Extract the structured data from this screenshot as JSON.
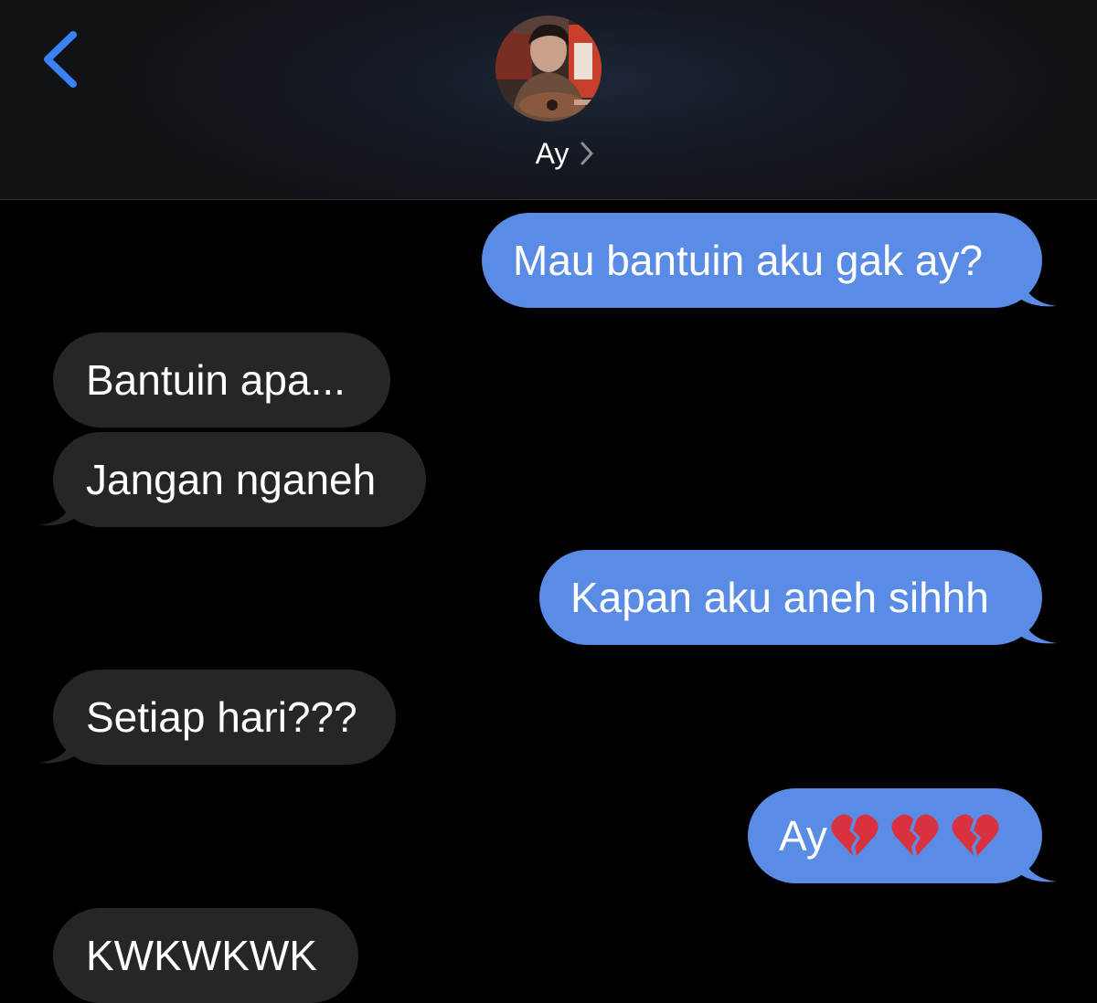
{
  "header": {
    "contact_name": "Ay",
    "accent_color": "#3a82f7"
  },
  "icons": {
    "back": "chevron-left-icon",
    "contact_details": "chevron-right-icon",
    "heart": "broken-heart-emoji"
  },
  "messages": [
    {
      "direction": "sent",
      "text": "Mau bantuin aku gak ay?"
    },
    {
      "direction": "received",
      "text": "Bantuin apa..."
    },
    {
      "direction": "received",
      "text": "Jangan nganeh"
    },
    {
      "direction": "sent",
      "text": "Kapan aku aneh sihhh"
    },
    {
      "direction": "received",
      "text": "Setiap hari???"
    },
    {
      "direction": "sent",
      "text": "Ay",
      "emoji": [
        "💔",
        "💔",
        "💔"
      ]
    },
    {
      "direction": "received",
      "text": "KWKWKWK"
    }
  ],
  "colors": {
    "sent_bubble": "#5a8ce6",
    "received_bubble": "#262628",
    "background": "#000000"
  }
}
